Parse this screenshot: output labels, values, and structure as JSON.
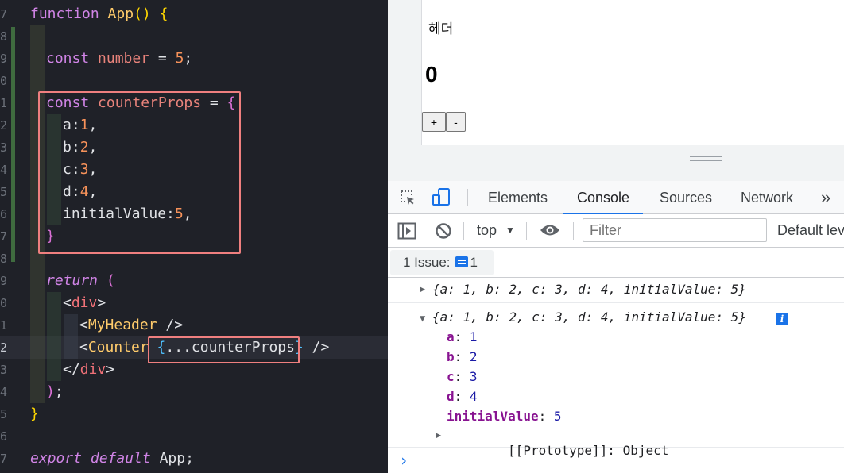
{
  "editor": {
    "lines": [
      {
        "num": "7",
        "tokens": [
          [
            "t-kw",
            "function "
          ],
          [
            "t-fn",
            "App"
          ],
          [
            "t-b1",
            "()"
          ],
          [
            "t-p",
            " "
          ],
          [
            "t-b1",
            "{"
          ]
        ]
      },
      {
        "num": "8",
        "tokens": []
      },
      {
        "num": "9",
        "tokens": [
          [
            "t-kw",
            "const "
          ],
          [
            "t-var",
            "number"
          ],
          [
            "t-p",
            " = "
          ],
          [
            "t-num",
            "5"
          ],
          [
            "t-p",
            ";"
          ]
        ]
      },
      {
        "num": "0",
        "tokens": []
      },
      {
        "num": "1",
        "tokens": [
          [
            "t-kw",
            "const "
          ],
          [
            "t-var",
            "counterProps"
          ],
          [
            "t-p",
            " = "
          ],
          [
            "t-b2",
            "{"
          ]
        ]
      },
      {
        "num": "2",
        "tokens": [
          [
            "t-key",
            "a"
          ],
          [
            "t-p",
            ":"
          ],
          [
            "t-num",
            "1"
          ],
          [
            "t-p",
            ","
          ]
        ]
      },
      {
        "num": "3",
        "tokens": [
          [
            "t-key",
            "b"
          ],
          [
            "t-p",
            ":"
          ],
          [
            "t-num",
            "2"
          ],
          [
            "t-p",
            ","
          ]
        ]
      },
      {
        "num": "4",
        "tokens": [
          [
            "t-key",
            "c"
          ],
          [
            "t-p",
            ":"
          ],
          [
            "t-num",
            "3"
          ],
          [
            "t-p",
            ","
          ]
        ]
      },
      {
        "num": "5",
        "tokens": [
          [
            "t-key",
            "d"
          ],
          [
            "t-p",
            ":"
          ],
          [
            "t-num",
            "4"
          ],
          [
            "t-p",
            ","
          ]
        ]
      },
      {
        "num": "6",
        "tokens": [
          [
            "t-key",
            "initialValue"
          ],
          [
            "t-p",
            ":"
          ],
          [
            "t-num",
            "5"
          ],
          [
            "t-p",
            ","
          ]
        ]
      },
      {
        "num": "7",
        "tokens": [
          [
            "t-b2",
            "}"
          ]
        ]
      },
      {
        "num": "8",
        "tokens": []
      },
      {
        "num": "9",
        "tokens": [
          [
            "t-kwi",
            "return "
          ],
          [
            "t-b2",
            "("
          ]
        ]
      },
      {
        "num": "0",
        "tokens": [
          [
            "t-p",
            "<"
          ],
          [
            "t-tag",
            "div"
          ],
          [
            "t-p",
            ">"
          ]
        ]
      },
      {
        "num": "1",
        "tokens": [
          [
            "t-p",
            "<"
          ],
          [
            "t-cmp",
            "MyHeader"
          ],
          [
            "t-p",
            " />"
          ]
        ]
      },
      {
        "num": "2",
        "tokens": [
          [
            "t-p",
            "<"
          ],
          [
            "t-cmp",
            "Counter"
          ],
          [
            "t-p",
            " "
          ],
          [
            "t-b3",
            "{"
          ],
          [
            "t-p",
            "..."
          ],
          [
            "t-key",
            "counterProps"
          ],
          [
            "t-b3",
            "}"
          ],
          [
            "t-p",
            " />"
          ]
        ]
      },
      {
        "num": "3",
        "tokens": [
          [
            "t-p",
            "</"
          ],
          [
            "t-tag",
            "div"
          ],
          [
            "t-p",
            ">"
          ]
        ]
      },
      {
        "num": "4",
        "tokens": [
          [
            "t-b2",
            ")"
          ],
          [
            "t-p",
            ";"
          ]
        ]
      },
      {
        "num": "5",
        "tokens": [
          [
            "t-b1",
            "}"
          ]
        ]
      },
      {
        "num": "6",
        "tokens": []
      },
      {
        "num": "7",
        "tokens": [
          [
            "t-kwi",
            "export default "
          ],
          [
            "t-p",
            "App;"
          ]
        ]
      }
    ]
  },
  "preview": {
    "header_text": "헤더",
    "counter_value": "0",
    "plus_label": "+",
    "minus_label": "-"
  },
  "devtools": {
    "tabs": [
      {
        "label": "Elements"
      },
      {
        "label": "Console",
        "active": true
      },
      {
        "label": "Sources"
      },
      {
        "label": "Network"
      }
    ],
    "more_tabs": "»",
    "context": "top",
    "filter_placeholder": "Filter",
    "log_level": "Default lev",
    "issues_label": "1 Issue:",
    "issues_count": "1",
    "log_collapsed": "{a: 1, b: 2, c: 3, d: 4, initialValue: 5}",
    "log_expanded": "{a: 1, b: 2, c: 3, d: 4, initialValue: 5}",
    "info_badge": "i",
    "props": [
      {
        "name": "a",
        "value": "1"
      },
      {
        "name": "b",
        "value": "2"
      },
      {
        "name": "c",
        "value": "3"
      },
      {
        "name": "d",
        "value": "4"
      },
      {
        "name": "initialValue",
        "value": "5"
      }
    ],
    "prototype_label": "[[Prototype]]",
    "prototype_value": "Object",
    "prompt_glyph": "›"
  },
  "colors": {
    "editor_bg": "#1f2128",
    "highlight_box": "#ef7f7f",
    "devtools_accent": "#1a73e8"
  }
}
